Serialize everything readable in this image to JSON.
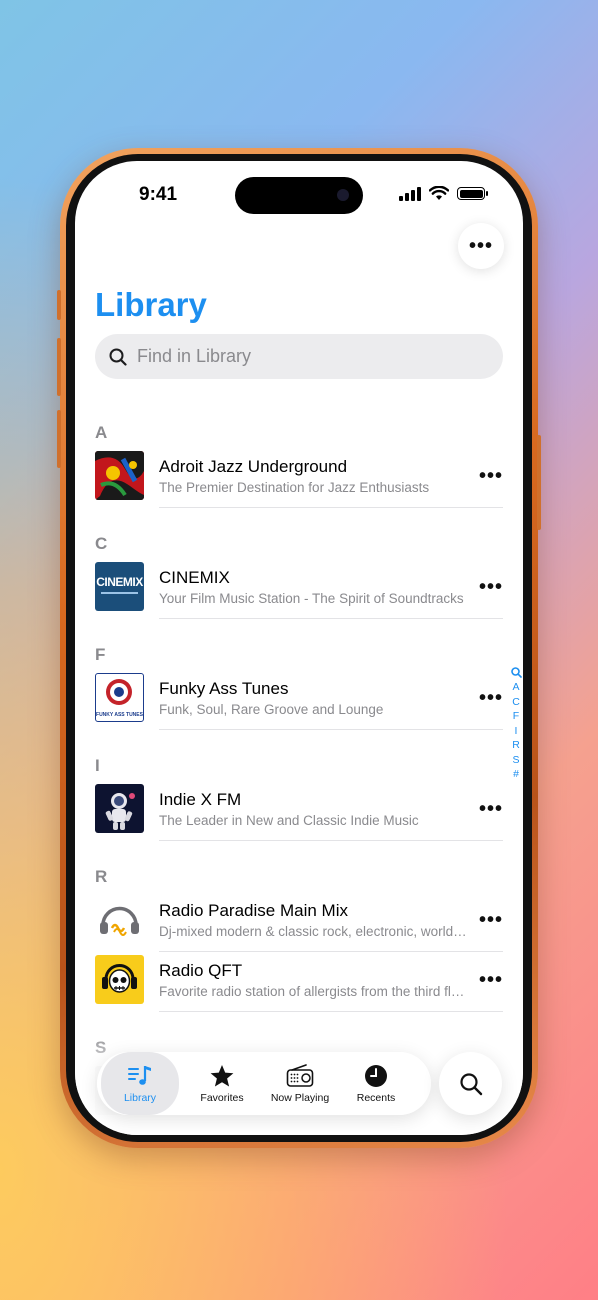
{
  "status": {
    "time": "9:41"
  },
  "header": {
    "title": "Library",
    "more_icon": "ellipsis-icon"
  },
  "search": {
    "placeholder": "Find in Library"
  },
  "sections": [
    {
      "letter": "A",
      "items": [
        {
          "title": "Adroit Jazz Underground",
          "subtitle": "The Premier Destination for Jazz Enthusiasts"
        }
      ]
    },
    {
      "letter": "C",
      "items": [
        {
          "title": "CINEMIX",
          "subtitle": "Your Film Music Station - The Spirit of Soundtracks"
        }
      ]
    },
    {
      "letter": "F",
      "items": [
        {
          "title": "Funky Ass Tunes",
          "subtitle": "Funk, Soul, Rare Groove and Lounge"
        }
      ]
    },
    {
      "letter": "I",
      "items": [
        {
          "title": "Indie X FM",
          "subtitle": "The Leader in New and Classic Indie Music"
        }
      ]
    },
    {
      "letter": "R",
      "items": [
        {
          "title": "Radio Paradise Main Mix",
          "subtitle": "Dj-mixed modern & classic rock, electronic, world music"
        },
        {
          "title": "Radio QFT",
          "subtitle": "Favorite radio station of allergists from the third floor"
        }
      ]
    },
    {
      "letter": "S",
      "items": []
    }
  ],
  "artwork_text": {
    "cinemix": "CINEMIX",
    "funky": "FUNKY ASS TUNES"
  },
  "index": [
    "A",
    "C",
    "F",
    "I",
    "R",
    "S",
    "#"
  ],
  "tabs": [
    {
      "label": "Library",
      "icon": "music-list-icon",
      "active": true
    },
    {
      "label": "Favorites",
      "icon": "star-icon"
    },
    {
      "label": "Now Playing",
      "icon": "radio-icon"
    },
    {
      "label": "Recents",
      "icon": "clock-icon"
    }
  ],
  "colors": {
    "accent": "#1d8ff0",
    "secondary_text": "#8a8a8e"
  }
}
